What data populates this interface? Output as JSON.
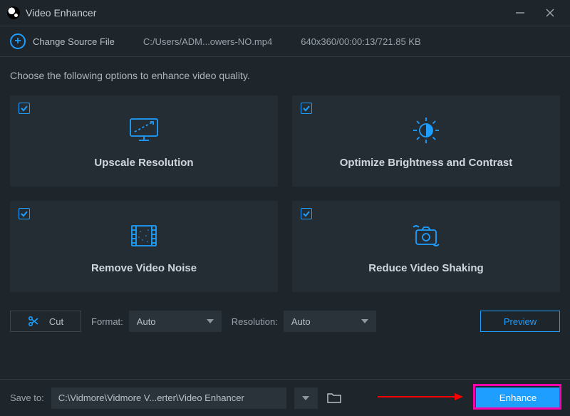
{
  "app": {
    "title": "Video Enhancer"
  },
  "sourcebar": {
    "change_label": "Change Source File",
    "path": "C:/Users/ADM...owers-NO.mp4",
    "meta": "640x360/00:00:13/721.85 KB"
  },
  "instruction": "Choose the following options to enhance video quality.",
  "cards": [
    {
      "label": "Upscale Resolution",
      "checked": true,
      "icon": "monitor-upscale"
    },
    {
      "label": "Optimize Brightness and Contrast",
      "checked": true,
      "icon": "brightness"
    },
    {
      "label": "Remove Video Noise",
      "checked": true,
      "icon": "film-noise"
    },
    {
      "label": "Reduce Video Shaking",
      "checked": true,
      "icon": "camera-shake"
    }
  ],
  "toolbar": {
    "cut_label": "Cut",
    "format_label": "Format:",
    "format_value": "Auto",
    "resolution_label": "Resolution:",
    "resolution_value": "Auto",
    "preview_label": "Preview"
  },
  "savebar": {
    "label": "Save to:",
    "path": "C:\\Vidmore\\Vidmore V...erter\\Video Enhancer",
    "enhance_label": "Enhance"
  },
  "colors": {
    "accent": "#1e9fff",
    "annotation": "#ff00aa"
  }
}
